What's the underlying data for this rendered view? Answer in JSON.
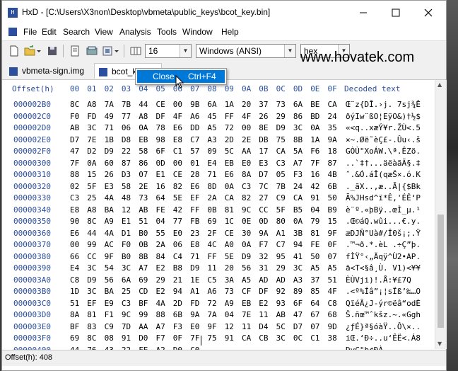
{
  "window": {
    "title": "HxD - [C:\\Users\\X3non\\Desktop\\vbmeta\\public_keys\\bcot_key.bin]",
    "app_icon_text": "HxD",
    "min_icon": "minimize-icon",
    "max_icon": "maximize-icon",
    "close_icon": "close-icon"
  },
  "menu": [
    "File",
    "Edit",
    "Search",
    "View",
    "Analysis",
    "Tools",
    "Window",
    "Help"
  ],
  "toolbar": {
    "bytes_per_row": "16",
    "charset": "Windows (ANSI)",
    "display": "hex"
  },
  "watermark": "www.hovatek.com",
  "tabs": [
    {
      "label": "vbmeta-sign.img"
    },
    {
      "label": "bcot_key.bin"
    }
  ],
  "context_menu": {
    "label": "Close",
    "shortcut": "Ctrl+F4"
  },
  "editor": {
    "offset_header": "Offset(h)",
    "col_headers": [
      "00",
      "01",
      "02",
      "03",
      "04",
      "05",
      "06",
      "07",
      "08",
      "09",
      "0A",
      "0B",
      "0C",
      "0D",
      "0E",
      "0F"
    ],
    "decoded_header": "Decoded text",
    "rows": [
      {
        "off": "000002B0",
        "hex": "8C A8 7A 7B 44 CE 00 9B 6A 1A 20 37 73 6A BE CA",
        "asc": "Œ¨z{DÎ.›j. 7sj¾Ê"
      },
      {
        "off": "000002C0",
        "hex": "F0 FD 49 77 A8 DF 4F A6 45 FF 4F 26 29 86 BD 24",
        "asc": "ðýIw¨ßO¦EÿO&)†½$"
      },
      {
        "off": "000002D0",
        "hex": "AB 3C 71 06 0A 78 E6 DD A5 72 00 8E D9 3C 0A 35",
        "asc": "«<q..xæÝ¥r.ŽÙ<.5"
      },
      {
        "off": "000002E0",
        "hex": "D7 7E 1B D8 EB 98 E8 C7 A3 2D 2E DB 75 8B 1A 9A",
        "asc": "×~.Øë˜èÇ£-.Ûu‹.š"
      },
      {
        "off": "000002F0",
        "hex": "47 D2 D9 22 58 6F C1 57 09 5C AA 17 CA 5A F6 18",
        "asc": "GÒÙ\"XoÁW.\\ª.ÊZö."
      },
      {
        "off": "00000300",
        "hex": "7F 0A 60 87 86 0D 00 01 E4 EB E0 E3 C3 A7 7F 87",
        "asc": "..`‡†...äëàãÃ§.‡"
      },
      {
        "off": "00000310",
        "hex": "88 15 26 D3 07 E1 CE 28 71 E6 8A D7 05 F3 16 4B",
        "asc": "ˆ.&Ó.áÎ(qæŠ×.ó.K"
      },
      {
        "off": "00000320",
        "hex": "02 5F E3 58 2E 16 82 E6 8D 0A C3 7C 7B 24 42 6B",
        "asc": "._ãX..‚æ..Ã|{$Bk"
      },
      {
        "off": "00000330",
        "hex": "C3 25 4A 48 73 64 5E EF 2A CA 82 27 C9 CA 91 50",
        "asc": "Ã%JHsd^ï*Ê‚'ÉÊ‘P"
      },
      {
        "off": "00000340",
        "hex": "E8 A8 BA 12 AB FE 42 FF 0B 81 9C CC 5F B5 04 B9",
        "asc": "è¨º.«þBÿ..œÌ_µ.¹"
      },
      {
        "off": "00000350",
        "hex": "90 8C A9 E1 51 04 77 FB 69 1C 0E 0D 80 0A 79 15",
        "asc": ".Œ©áQ.wûi...€.y."
      },
      {
        "off": "00000360",
        "hex": "E6 44 4A D1 B0 55 E0 23 2F CE 30 9A A1 3B 81 9F",
        "asc": "æDJÑ°Uà#/Î0š¡;.Ÿ"
      },
      {
        "off": "00000370",
        "hex": "00 99 AC F0 0B 2A 06 E8 4C A0 0A F7 C7 94 FE 0F",
        "asc": ".™¬ð.*.èL .÷Ç”þ."
      },
      {
        "off": "00000380",
        "hex": "66 CC 9F B0 8B 84 C4 71 FF 5E D9 32 95 41 50 07",
        "asc": "fÌŸ°‹„Äqÿ^Ù2•AP."
      },
      {
        "off": "00000390",
        "hex": "E4 3C 54 3C A7 E2 B8 D9 11 20 56 31 29 3C A5 A5",
        "asc": "ä<T<§â¸Ù. V1)<¥¥"
      },
      {
        "off": "000003A0",
        "hex": "C8 D9 56 6A 69 29 21 1E C5 3A A5 AD AD A3 37 51",
        "asc": "ÈÙVji)!.Å:¥­­£7Q"
      },
      {
        "off": "000003B0",
        "hex": "1D 3C BA 25 CD E2 94 A1 A6 73 CF DF 92 89 85 4F",
        "asc": ".<º%Íâ”¡¦sÏß’‰…O"
      },
      {
        "off": "000003C0",
        "hex": "51 EF E9 C3 BF 4A 2D FD 72 A9 EB E2 93 6F 64 C8",
        "asc": "QïéÃ¿J-ýr©ëâ“odÈ"
      },
      {
        "off": "000003D0",
        "hex": "8A 81 F1 9C 99 88 6B 9A 7A 04 7E 11 AB 47 67 68",
        "asc": "Š.ñœ™ˆkšz.~.«Ggh"
      },
      {
        "off": "000003E0",
        "hex": "BF 83 C9 7D AA A7 F3 E0 9F 12 11 D4 5C D7 07 9D",
        "asc": "¿ƒÉ}ª§óàŸ..Ô\\×.."
      },
      {
        "off": "000003F0",
        "hex": "69 8C 08 91 D0 F7 0F 7F 75 91 CA CB 3C 0C C1 38",
        "asc": "iŒ.‘Ð÷..u‘ÊË<.Á8"
      },
      {
        "off": "00000400",
        "hex": "44 76 43 22 FE A2 D0 C0",
        "asc": "DvC\"þ¢ÐÀ"
      }
    ]
  },
  "status": {
    "offset": "Offset(h): 408"
  }
}
